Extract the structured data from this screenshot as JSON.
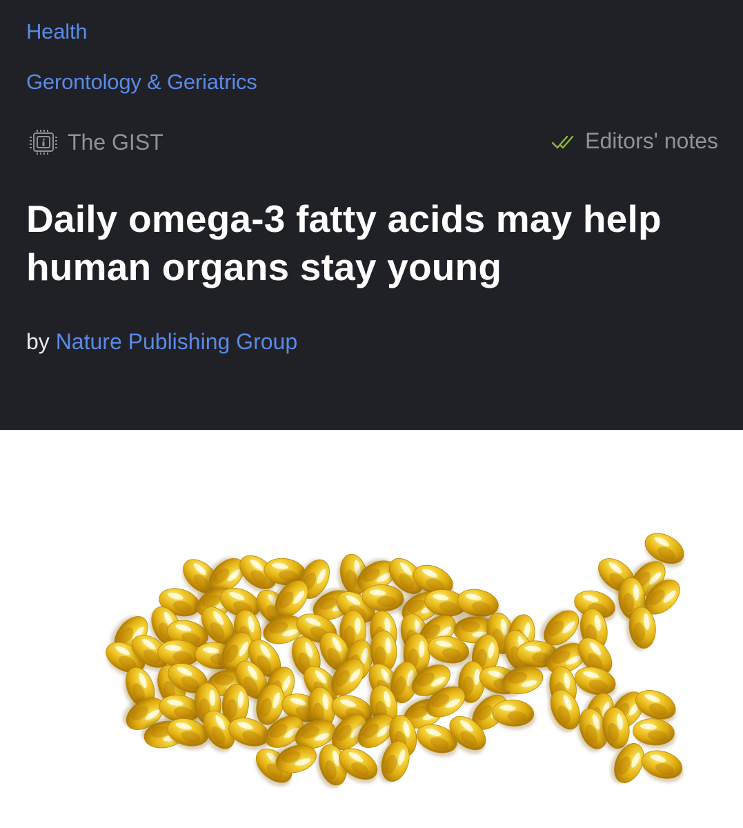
{
  "breadcrumbs": {
    "category": "Health",
    "subcategory": "Gerontology & Geriatrics"
  },
  "meta": {
    "gist_label": "The GIST",
    "gist_icon": "chip-info-icon",
    "editors_label": "Editors' notes",
    "editors_icon": "double-check-icon"
  },
  "article": {
    "title": "Daily omega-3 fatty acids may help human organs stay young",
    "byline_prefix": "by",
    "author": "Nature Publishing Group"
  },
  "colors": {
    "header_bg": "#1f2127",
    "link": "#5b8ae6",
    "muted": "#8d939b",
    "check": "#8fb83a",
    "capsule": "#e5b518"
  }
}
